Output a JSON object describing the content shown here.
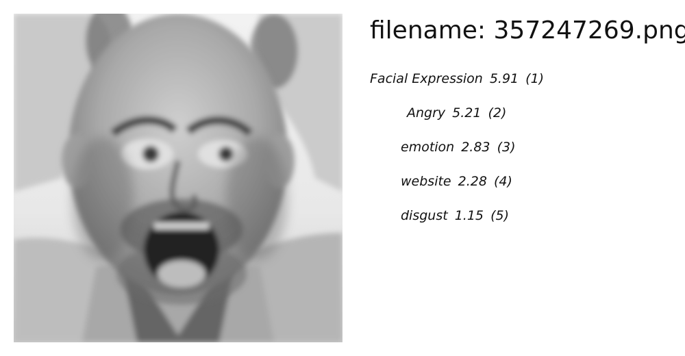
{
  "file": {
    "label": "filename:",
    "name": "357247269.png"
  },
  "image": {
    "icon": "face-photo-icon",
    "grayscale": true
  },
  "tags": [
    {
      "label": "Facial Expression",
      "score": "5.91",
      "rank": "(1)"
    },
    {
      "label": "Angry",
      "score": "5.21",
      "rank": "(2)"
    },
    {
      "label": "emotion",
      "score": "2.83",
      "rank": "(3)"
    },
    {
      "label": "website",
      "score": "2.28",
      "rank": "(4)"
    },
    {
      "label": "disgust",
      "score": "1.15",
      "rank": "(5)"
    }
  ]
}
